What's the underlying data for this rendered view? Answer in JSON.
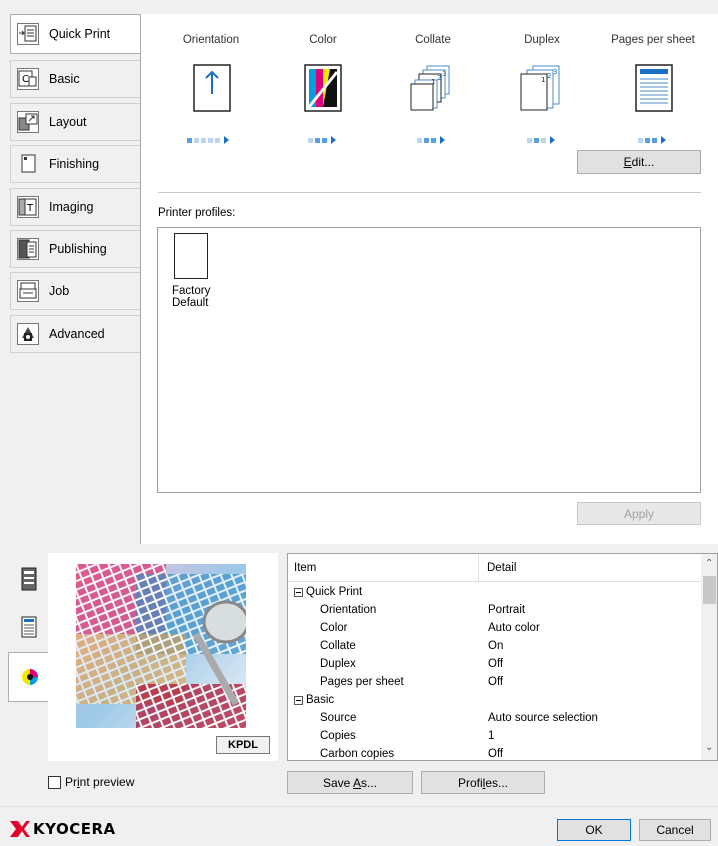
{
  "tabs": [
    {
      "label": "Quick Print",
      "icon": "quick-print-icon"
    },
    {
      "label": "Basic",
      "icon": "basic-icon"
    },
    {
      "label": "Layout",
      "icon": "layout-icon"
    },
    {
      "label": "Finishing",
      "icon": "finishing-icon"
    },
    {
      "label": "Imaging",
      "icon": "imaging-icon"
    },
    {
      "label": "Publishing",
      "icon": "publishing-icon"
    },
    {
      "label": "Job",
      "icon": "job-icon"
    },
    {
      "label": "Advanced",
      "icon": "advanced-icon"
    }
  ],
  "quick_print": {
    "columns": [
      "Orientation",
      "Color",
      "Collate",
      "Duplex",
      "Pages per sheet"
    ],
    "edit_label": "Edit...",
    "edit_mnemonic": "E"
  },
  "profiles": {
    "label": "Printer profiles:",
    "items": [
      {
        "line1": "Factory",
        "line2": "Default"
      }
    ],
    "apply_label": "Apply"
  },
  "preview": {
    "badge": "KPDL",
    "checkbox_label_pre": "Pr",
    "checkbox_label_mn": "i",
    "checkbox_label_post": "nt preview",
    "checked": false
  },
  "summary": {
    "headers": [
      "Item",
      "Detail"
    ],
    "rows": [
      {
        "type": "group",
        "item": "Quick Print",
        "detail": ""
      },
      {
        "type": "item",
        "item": "Orientation",
        "detail": "Portrait"
      },
      {
        "type": "item",
        "item": "Color",
        "detail": "Auto color"
      },
      {
        "type": "item",
        "item": "Collate",
        "detail": "On"
      },
      {
        "type": "item",
        "item": "Duplex",
        "detail": "Off"
      },
      {
        "type": "item",
        "item": "Pages per sheet",
        "detail": "Off"
      },
      {
        "type": "group",
        "item": "Basic",
        "detail": ""
      },
      {
        "type": "item",
        "item": "Source",
        "detail": "Auto source selection"
      },
      {
        "type": "item",
        "item": "Copies",
        "detail": "1"
      },
      {
        "type": "item",
        "item": "Carbon copies",
        "detail": "Off"
      }
    ]
  },
  "buttons": {
    "save_as_pre": "Save ",
    "save_as_mn": "A",
    "save_as_post": "s...",
    "profiles_pre": "Profi",
    "profiles_mn": "l",
    "profiles_post": "es...",
    "ok": "OK",
    "cancel": "Cancel"
  },
  "brand": {
    "name": "KYOCERA",
    "color": "#e4002b"
  },
  "colors": {
    "accent_blue": "#1a6fc4",
    "light_blue": "#b8d6f2"
  }
}
